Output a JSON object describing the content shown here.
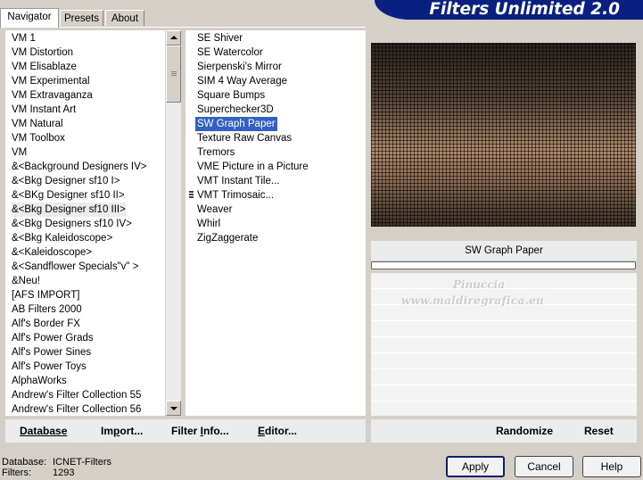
{
  "window": {
    "title": "Filters Unlimited 2.0",
    "accent": "#0a2080"
  },
  "tabs": [
    {
      "label": "Navigator",
      "active": true
    },
    {
      "label": "Presets",
      "active": false
    },
    {
      "label": "About",
      "active": false
    }
  ],
  "categories": [
    "VM 1",
    "VM Distortion",
    "VM Elisablaze",
    "VM Experimental",
    "VM Extravaganza",
    "VM Instant Art",
    "VM Natural",
    "VM Toolbox",
    "VM",
    "&<Background Designers IV>",
    "&<Bkg Designer sf10 I>",
    "&<BKg Designer sf10 II>",
    "&<Bkg Designer sf10 III>",
    "&<Bkg Designers sf10 IV>",
    "&<Bkg Kaleidoscope>",
    "&<Kaleidoscope>",
    "&<Sandflower Specials\"v\" >",
    "&Neu!",
    "[AFS IMPORT]",
    "AB Filters 2000",
    "Alf's Border FX",
    "Alf's Power Grads",
    "Alf's Power Sines",
    "Alf's Power Toys",
    "AlphaWorks",
    "Andrew's Filter Collection 55",
    "Andrew's Filter Collection 56"
  ],
  "selected_category": "&<Bkg Designer sf10 III>",
  "filters": [
    "SE Shiver",
    "SE Watercolor",
    "Sierpenski's Mirror",
    "SIM 4 Way Average",
    "Square Bumps",
    "Superchecker3D",
    "SW Graph Paper",
    "Texture Raw Canvas",
    "Tremors",
    "VME Picture in a Picture",
    "VMT Instant Tile...",
    "VMT Trimosaic...",
    "Weaver",
    "Whirl",
    "ZigZaggerate"
  ],
  "selected_filter": "SW Graph Paper",
  "preview": {
    "filter_name": "SW Graph Paper",
    "watermark_line1": "Pinuccia",
    "watermark_line2": "www.maldiregrafica.eu"
  },
  "buttons_left": {
    "database": "Database",
    "import_prefix": "Im",
    "import_u": "p",
    "import_suffix": "ort...",
    "filter_info_prefix": "Filter ",
    "filter_info_u": "I",
    "filter_info_suffix": "nfo...",
    "editor_u": "E",
    "editor_suffix": "ditor..."
  },
  "buttons_right": {
    "randomize": "Randomize",
    "reset": "Reset"
  },
  "status": {
    "database_label": "Database:",
    "database_value": "ICNET-Filters",
    "filters_label": "Filters:",
    "filters_value": "1293"
  },
  "dialog_buttons": {
    "apply": "Apply",
    "cancel": "Cancel",
    "help": "Help"
  }
}
